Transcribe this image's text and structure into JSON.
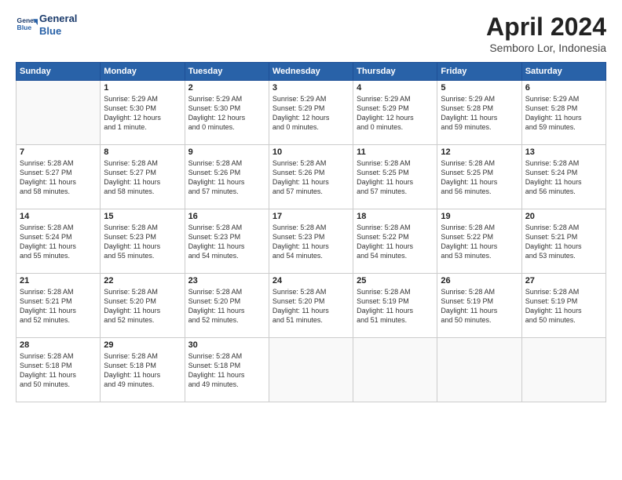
{
  "header": {
    "logo_line1": "General",
    "logo_line2": "Blue",
    "month": "April 2024",
    "location": "Semboro Lor, Indonesia"
  },
  "days_of_week": [
    "Sunday",
    "Monday",
    "Tuesday",
    "Wednesday",
    "Thursday",
    "Friday",
    "Saturday"
  ],
  "weeks": [
    [
      {
        "day": "",
        "info": ""
      },
      {
        "day": "1",
        "info": "Sunrise: 5:29 AM\nSunset: 5:30 PM\nDaylight: 12 hours\nand 1 minute."
      },
      {
        "day": "2",
        "info": "Sunrise: 5:29 AM\nSunset: 5:30 PM\nDaylight: 12 hours\nand 0 minutes."
      },
      {
        "day": "3",
        "info": "Sunrise: 5:29 AM\nSunset: 5:29 PM\nDaylight: 12 hours\nand 0 minutes."
      },
      {
        "day": "4",
        "info": "Sunrise: 5:29 AM\nSunset: 5:29 PM\nDaylight: 12 hours\nand 0 minutes."
      },
      {
        "day": "5",
        "info": "Sunrise: 5:29 AM\nSunset: 5:28 PM\nDaylight: 11 hours\nand 59 minutes."
      },
      {
        "day": "6",
        "info": "Sunrise: 5:29 AM\nSunset: 5:28 PM\nDaylight: 11 hours\nand 59 minutes."
      }
    ],
    [
      {
        "day": "7",
        "info": "Sunrise: 5:28 AM\nSunset: 5:27 PM\nDaylight: 11 hours\nand 58 minutes."
      },
      {
        "day": "8",
        "info": "Sunrise: 5:28 AM\nSunset: 5:27 PM\nDaylight: 11 hours\nand 58 minutes."
      },
      {
        "day": "9",
        "info": "Sunrise: 5:28 AM\nSunset: 5:26 PM\nDaylight: 11 hours\nand 57 minutes."
      },
      {
        "day": "10",
        "info": "Sunrise: 5:28 AM\nSunset: 5:26 PM\nDaylight: 11 hours\nand 57 minutes."
      },
      {
        "day": "11",
        "info": "Sunrise: 5:28 AM\nSunset: 5:25 PM\nDaylight: 11 hours\nand 57 minutes."
      },
      {
        "day": "12",
        "info": "Sunrise: 5:28 AM\nSunset: 5:25 PM\nDaylight: 11 hours\nand 56 minutes."
      },
      {
        "day": "13",
        "info": "Sunrise: 5:28 AM\nSunset: 5:24 PM\nDaylight: 11 hours\nand 56 minutes."
      }
    ],
    [
      {
        "day": "14",
        "info": "Sunrise: 5:28 AM\nSunset: 5:24 PM\nDaylight: 11 hours\nand 55 minutes."
      },
      {
        "day": "15",
        "info": "Sunrise: 5:28 AM\nSunset: 5:23 PM\nDaylight: 11 hours\nand 55 minutes."
      },
      {
        "day": "16",
        "info": "Sunrise: 5:28 AM\nSunset: 5:23 PM\nDaylight: 11 hours\nand 54 minutes."
      },
      {
        "day": "17",
        "info": "Sunrise: 5:28 AM\nSunset: 5:23 PM\nDaylight: 11 hours\nand 54 minutes."
      },
      {
        "day": "18",
        "info": "Sunrise: 5:28 AM\nSunset: 5:22 PM\nDaylight: 11 hours\nand 54 minutes."
      },
      {
        "day": "19",
        "info": "Sunrise: 5:28 AM\nSunset: 5:22 PM\nDaylight: 11 hours\nand 53 minutes."
      },
      {
        "day": "20",
        "info": "Sunrise: 5:28 AM\nSunset: 5:21 PM\nDaylight: 11 hours\nand 53 minutes."
      }
    ],
    [
      {
        "day": "21",
        "info": "Sunrise: 5:28 AM\nSunset: 5:21 PM\nDaylight: 11 hours\nand 52 minutes."
      },
      {
        "day": "22",
        "info": "Sunrise: 5:28 AM\nSunset: 5:20 PM\nDaylight: 11 hours\nand 52 minutes."
      },
      {
        "day": "23",
        "info": "Sunrise: 5:28 AM\nSunset: 5:20 PM\nDaylight: 11 hours\nand 52 minutes."
      },
      {
        "day": "24",
        "info": "Sunrise: 5:28 AM\nSunset: 5:20 PM\nDaylight: 11 hours\nand 51 minutes."
      },
      {
        "day": "25",
        "info": "Sunrise: 5:28 AM\nSunset: 5:19 PM\nDaylight: 11 hours\nand 51 minutes."
      },
      {
        "day": "26",
        "info": "Sunrise: 5:28 AM\nSunset: 5:19 PM\nDaylight: 11 hours\nand 50 minutes."
      },
      {
        "day": "27",
        "info": "Sunrise: 5:28 AM\nSunset: 5:19 PM\nDaylight: 11 hours\nand 50 minutes."
      }
    ],
    [
      {
        "day": "28",
        "info": "Sunrise: 5:28 AM\nSunset: 5:18 PM\nDaylight: 11 hours\nand 50 minutes."
      },
      {
        "day": "29",
        "info": "Sunrise: 5:28 AM\nSunset: 5:18 PM\nDaylight: 11 hours\nand 49 minutes."
      },
      {
        "day": "30",
        "info": "Sunrise: 5:28 AM\nSunset: 5:18 PM\nDaylight: 11 hours\nand 49 minutes."
      },
      {
        "day": "",
        "info": ""
      },
      {
        "day": "",
        "info": ""
      },
      {
        "day": "",
        "info": ""
      },
      {
        "day": "",
        "info": ""
      }
    ]
  ]
}
